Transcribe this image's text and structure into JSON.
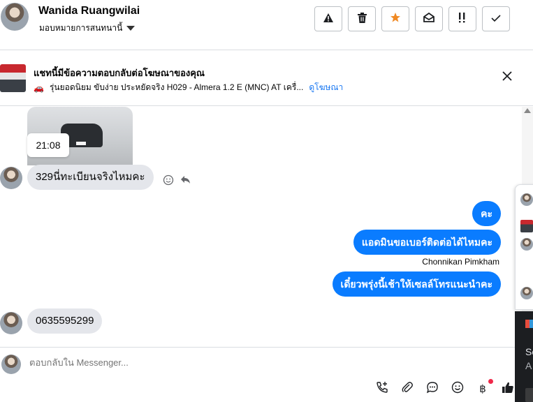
{
  "header": {
    "name": "Wanida Ruangwilai",
    "assign_label": "มอบหมายการสนทนานี้",
    "toolbar": [
      {
        "icon": "warning-icon",
        "glyph": "⚠"
      },
      {
        "icon": "trash-icon",
        "glyph": "🗑"
      },
      {
        "icon": "star-icon",
        "glyph": "★"
      },
      {
        "icon": "mark-unread-icon",
        "glyph": "✉"
      },
      {
        "icon": "follow-up-icon",
        "glyph": "!!"
      },
      {
        "icon": "done-check-icon",
        "glyph": "✓"
      }
    ]
  },
  "ad": {
    "title": "แชทนี้มีข้อความตอบกลับต่อโฆษณาของคุณ",
    "subtitle": "รุ่นยอดนิยม ขับง่าย ประหยัดจริง H029 - Almera 1.2 E (MNC) AT เครื่...",
    "link": "ดูโฆษณา"
  },
  "chat": {
    "timestamp": "21:08",
    "messages_in_1": "329นี่ทะเบียนจริงไหมคะ",
    "out_1": "คะ",
    "out_2": "แอดมินขอเบอร์ติดต่อได้ไหมคะ",
    "sender_name": "Chonnikan Pimkham",
    "out_3": "เดี๋ยวพรุ่งนี้เช้าให้เซลล์โทรแนะนำคะ",
    "messages_in_2": "0635595299"
  },
  "composer": {
    "placeholder": "ตอบกลับใน Messenger...",
    "actions": [
      "call-add-icon",
      "attach-icon",
      "saved-reply-icon",
      "emoji-icon",
      "payment-icon",
      "like-icon"
    ]
  },
  "side_panel": {
    "dark_text_1": "Se",
    "dark_text_2": "A"
  },
  "colors": {
    "outgoing_bubble": "#0a7cff",
    "incoming_bubble": "#e4e6eb",
    "link": "#1877f2",
    "star": "#f08a24"
  }
}
